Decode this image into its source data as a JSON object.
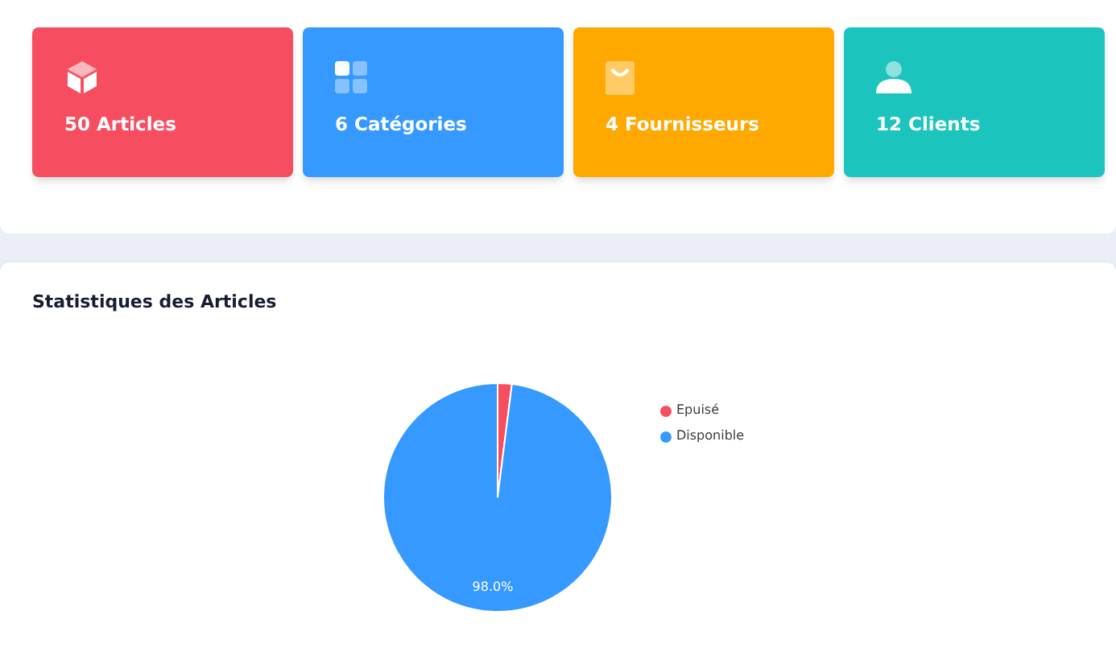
{
  "cards": [
    {
      "label": "50 Articles",
      "kind": "cube",
      "color": "#f64e60"
    },
    {
      "label": "6 Catégories",
      "kind": "grid",
      "color": "#3699ff"
    },
    {
      "label": "4 Fournisseurs",
      "kind": "bag",
      "color": "#ffa800"
    },
    {
      "label": "12 Clients",
      "kind": "user",
      "color": "#1bc5bd"
    }
  ],
  "stats": {
    "title": "Statistiques des Articles",
    "chart_data": {
      "type": "pie",
      "categories": [
        "Epuisé",
        "Disponible"
      ],
      "values": [
        2,
        98
      ],
      "colors": [
        "#f64e60",
        "#3699ff"
      ],
      "value_labels": [
        null,
        "98.0%"
      ]
    }
  }
}
